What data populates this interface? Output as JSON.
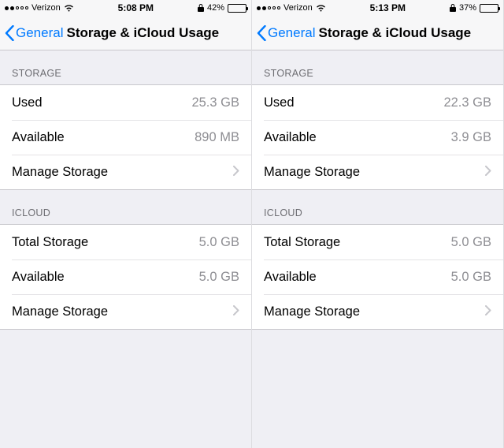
{
  "screens": [
    {
      "statusbar": {
        "carrier": "Verizon",
        "time": "5:08 PM",
        "battery_pct": "42%",
        "battery_fill": 42
      },
      "nav": {
        "back_label": "General",
        "title": "Storage & iCloud Usage"
      },
      "storage": {
        "header": "STORAGE",
        "used_label": "Used",
        "used_value": "25.3 GB",
        "avail_label": "Available",
        "avail_value": "890 MB",
        "manage_label": "Manage Storage"
      },
      "icloud": {
        "header": "ICLOUD",
        "total_label": "Total Storage",
        "total_value": "5.0 GB",
        "avail_label": "Available",
        "avail_value": "5.0 GB",
        "manage_label": "Manage Storage"
      }
    },
    {
      "statusbar": {
        "carrier": "Verizon",
        "time": "5:13 PM",
        "battery_pct": "37%",
        "battery_fill": 37
      },
      "nav": {
        "back_label": "General",
        "title": "Storage & iCloud Usage"
      },
      "storage": {
        "header": "STORAGE",
        "used_label": "Used",
        "used_value": "22.3 GB",
        "avail_label": "Available",
        "avail_value": "3.9 GB",
        "manage_label": "Manage Storage"
      },
      "icloud": {
        "header": "ICLOUD",
        "total_label": "Total Storage",
        "total_value": "5.0 GB",
        "avail_label": "Available",
        "avail_value": "5.0 GB",
        "manage_label": "Manage Storage"
      }
    }
  ]
}
